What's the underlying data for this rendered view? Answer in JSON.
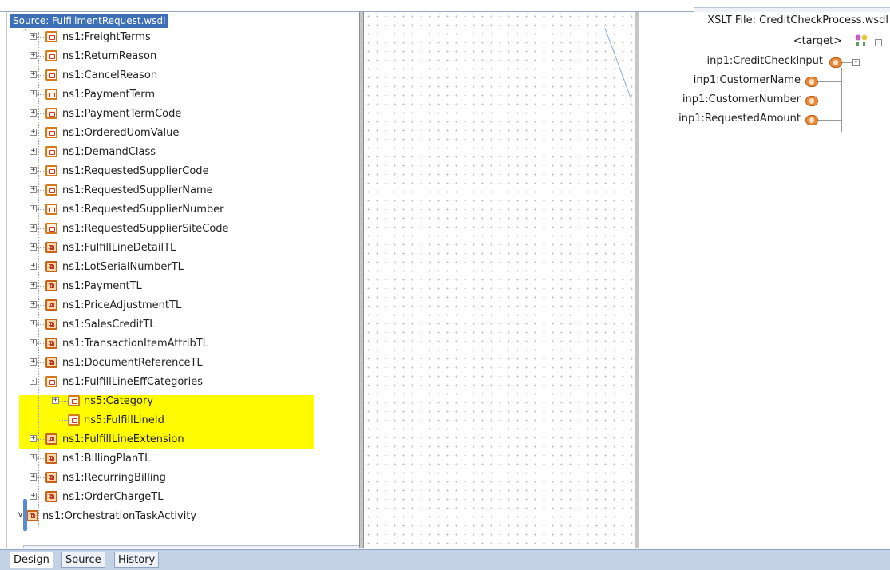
{
  "source": {
    "header": "Source: FulfillmentRequest.wsdl",
    "items": [
      {
        "label": "ns1:FreightTerms",
        "icon": "element"
      },
      {
        "label": "ns1:ReturnReason",
        "icon": "element"
      },
      {
        "label": "ns1:CancelReason",
        "icon": "element"
      },
      {
        "label": "ns1:PaymentTerm",
        "icon": "element"
      },
      {
        "label": "ns1:PaymentTermCode",
        "icon": "element"
      },
      {
        "label": "ns1:OrderedUomValue",
        "icon": "element"
      },
      {
        "label": "ns1:DemandClass",
        "icon": "element"
      },
      {
        "label": "ns1:RequestedSupplierCode",
        "icon": "element"
      },
      {
        "label": "ns1:RequestedSupplierName",
        "icon": "element"
      },
      {
        "label": "ns1:RequestedSupplierNumber",
        "icon": "element"
      },
      {
        "label": "ns1:RequestedSupplierSiteCode",
        "icon": "element"
      },
      {
        "label": "ns1:FulfillLineDetailTL",
        "icon": "complex"
      },
      {
        "label": "ns1:LotSerialNumberTL",
        "icon": "complex"
      },
      {
        "label": "ns1:PaymentTL",
        "icon": "complex"
      },
      {
        "label": "ns1:PriceAdjustmentTL",
        "icon": "complex"
      },
      {
        "label": "ns1:SalesCreditTL",
        "icon": "complex"
      },
      {
        "label": "ns1:TransactionItemAttribTL",
        "icon": "complex"
      },
      {
        "label": "ns1:DocumentReferenceTL",
        "icon": "complex"
      },
      {
        "label": "ns1:FulfillLineEffCategories",
        "icon": "element",
        "expanded": true,
        "highlighted": true
      },
      {
        "label": "ns5:Category",
        "icon": "element",
        "child": true,
        "highlighted": true
      },
      {
        "label": "ns5:FulfillLineId",
        "icon": "element",
        "child": true,
        "leaf": true,
        "highlighted": true
      },
      {
        "label": "ns1:FulfillLineExtension",
        "icon": "complex"
      },
      {
        "label": "ns1:BillingPlanTL",
        "icon": "complex"
      },
      {
        "label": "ns1:RecurringBilling",
        "icon": "complex"
      },
      {
        "label": "ns1:OrderChargeTL",
        "icon": "complex"
      },
      {
        "label": "ns1:OrchestrationTaskActivity",
        "icon": "complex",
        "parent": true
      }
    ],
    "highlight_color": "#fffb00"
  },
  "target": {
    "header": "XSLT File: CreditCheckProcess.wsdl",
    "root": "<target>",
    "input": "inp1:CreditCheckInput",
    "fields": [
      "inp1:CustomerName",
      "inp1:CustomerNumber",
      "inp1:RequestedAmount"
    ]
  },
  "tabs": [
    "Design",
    "Source",
    "History"
  ],
  "active_tab": "Design",
  "colors": {
    "accent": "#3d6fb6",
    "port": "#e8893a"
  }
}
